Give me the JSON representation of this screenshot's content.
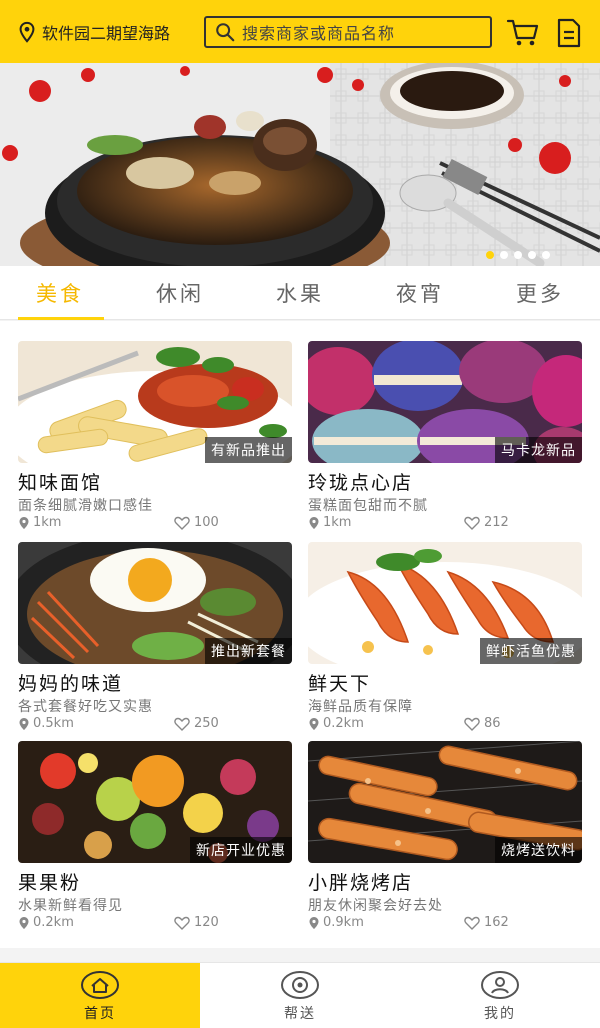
{
  "header": {
    "location": "软件园二期望海路",
    "search_placeholder": "搜索商家或商品名称",
    "icons": [
      "location-pin-icon",
      "search-icon",
      "cart-icon",
      "orders-icon"
    ]
  },
  "banner": {
    "slide_count": 5,
    "active_slide": 1
  },
  "categories": [
    {
      "label": "美食",
      "active": true
    },
    {
      "label": "休闲",
      "active": false
    },
    {
      "label": "水果",
      "active": false
    },
    {
      "label": "夜宵",
      "active": false
    },
    {
      "label": "更多",
      "active": false
    }
  ],
  "stores": [
    {
      "name": "知味面馆",
      "desc": "面条细腻滑嫩口感佳",
      "tag": "有新品推出",
      "distance": "1km",
      "likes": "100"
    },
    {
      "name": "玲珑点心店",
      "desc": "蛋糕面包甜而不腻",
      "tag": "马卡龙新品",
      "distance": "1km",
      "likes": "212"
    },
    {
      "name": "妈妈的味道",
      "desc": "各式套餐好吃又实惠",
      "tag": "推出新套餐",
      "distance": "0.5km",
      "likes": "250"
    },
    {
      "name": "鲜天下",
      "desc": "海鲜品质有保障",
      "tag": "鲜虾活鱼优惠",
      "distance": "0.2km",
      "likes": "86"
    },
    {
      "name": "果果粉",
      "desc": "水果新鲜看得见",
      "tag": "新店开业优惠",
      "distance": "0.2km",
      "likes": "120"
    },
    {
      "name": "小胖烧烤店",
      "desc": "朋友休闲聚会好去处",
      "tag": "烧烤送饮料",
      "distance": "0.9km",
      "likes": "162"
    }
  ],
  "tabbar": [
    {
      "label": "首页",
      "icon": "home-icon",
      "active": true
    },
    {
      "label": "帮送",
      "icon": "delivery-icon",
      "active": false
    },
    {
      "label": "我的",
      "icon": "profile-icon",
      "active": false
    }
  ],
  "colors": {
    "accent": "#ffd30b",
    "active_text": "#f5b800"
  }
}
